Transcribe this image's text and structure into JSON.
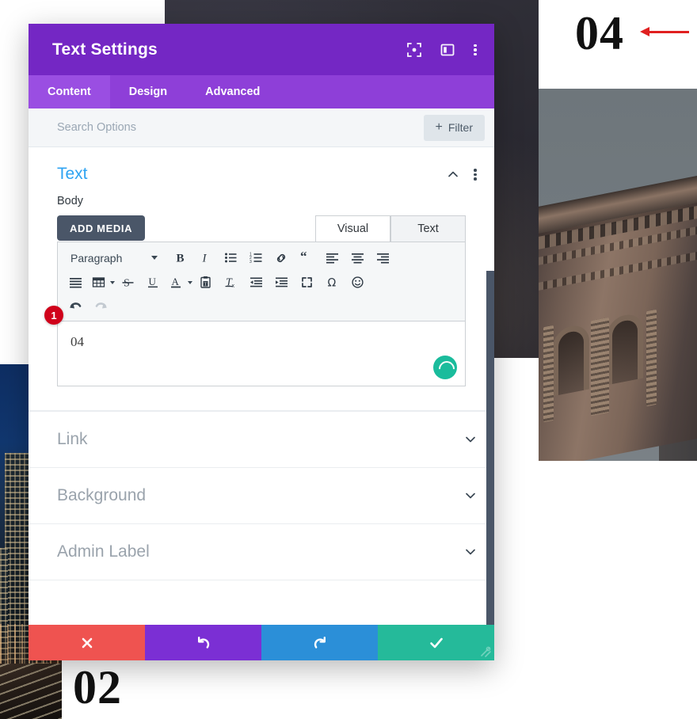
{
  "modal": {
    "title": "Text Settings",
    "header_icons": [
      {
        "name": "focus-target-icon"
      },
      {
        "name": "layout-panel-icon"
      },
      {
        "name": "more-vertical-icon"
      }
    ],
    "tabs": [
      {
        "label": "Content",
        "active": true
      },
      {
        "label": "Design",
        "active": false
      },
      {
        "label": "Advanced",
        "active": false
      }
    ],
    "search": {
      "placeholder": "Search Options",
      "value": "",
      "filter_label": "Filter",
      "filter_plus": "+"
    },
    "section": {
      "title": "Text",
      "collapse_icon": "chevron-up-icon",
      "menu_icon": "more-vertical-icon"
    },
    "body_field": {
      "label": "Body",
      "add_media_label": "ADD MEDIA",
      "editor_tabs": [
        {
          "label": "Visual",
          "active": true
        },
        {
          "label": "Text",
          "active": false
        }
      ],
      "toolbar": {
        "format_select": "Paragraph",
        "row1": [
          "bold-icon",
          "italic-icon",
          "bulleted-list-icon",
          "numbered-list-icon",
          "link-icon",
          "blockquote-icon",
          "align-left-icon",
          "align-center-icon",
          "align-right-icon"
        ],
        "row2": [
          "align-justify-icon",
          "table-icon",
          "strikethrough-icon",
          "underline-icon",
          "text-color-icon",
          "paste-as-text-icon",
          "clear-formatting-icon",
          "outdent-icon",
          "indent-icon",
          "fullscreen-icon",
          "special-character-icon",
          "emoji-icon"
        ],
        "row3": [
          "undo-icon",
          "redo-icon"
        ]
      },
      "content_text": "04",
      "spinner_icon": "loading-spinner-icon",
      "callout_badge": "1"
    },
    "collapsed_sections": [
      {
        "label": "Link",
        "icon": "chevron-down-icon"
      },
      {
        "label": "Background",
        "icon": "chevron-down-icon"
      },
      {
        "label": "Admin Label",
        "icon": "chevron-down-icon"
      }
    ],
    "footer_buttons": [
      {
        "name": "cancel-button",
        "icon": "close-x-icon",
        "color": "#ef5350"
      },
      {
        "name": "undo-button",
        "icon": "undo-arrow-icon",
        "color": "#7b2fd4"
      },
      {
        "name": "redo-button",
        "icon": "redo-arrow-icon",
        "color": "#2b8fd8"
      },
      {
        "name": "save-button",
        "icon": "checkmark-icon",
        "color": "#25ba9a"
      }
    ],
    "colors": {
      "header_purple": "#7427c4",
      "tabbar_purple": "#8e3fd8",
      "active_tab_purple": "#9a4ee2",
      "section_title_blue": "#2ea3f2",
      "badge_red": "#d0021b",
      "spinner_green": "#1abc9c"
    }
  },
  "background": {
    "numerals": [
      {
        "value": "04",
        "name": "page-number-04"
      },
      {
        "value": "02",
        "name": "page-number-02"
      }
    ],
    "annotation_arrow": {
      "name": "red-arrow-annotation",
      "color": "#e02020"
    }
  }
}
